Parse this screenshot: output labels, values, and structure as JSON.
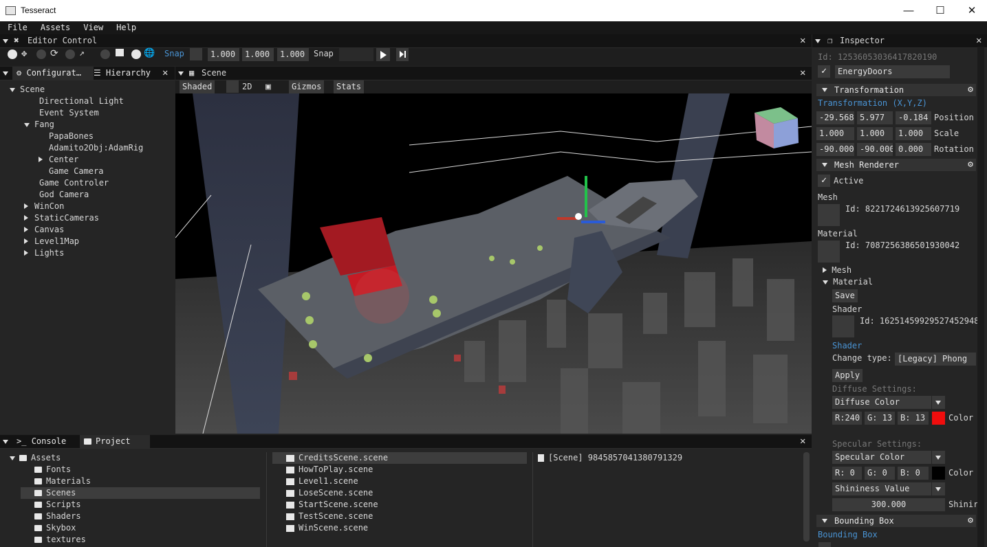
{
  "app": {
    "title": "Tesseract"
  },
  "menu": [
    "File",
    "Assets",
    "View",
    "Help"
  ],
  "editor_control": {
    "title": "Editor Control",
    "snap_label": "Snap",
    "snap_values": [
      "1.000",
      "1.000",
      "1.000"
    ],
    "snap2_label": "Snap"
  },
  "left_tabs": {
    "config": "Configurat…",
    "hierarchy": "Hierarchy"
  },
  "hierarchy": [
    {
      "label": "Scene",
      "arrow": "down",
      "depth": 0
    },
    {
      "label": "Directional Light",
      "arrow": "",
      "depth": 1
    },
    {
      "label": "Event System",
      "arrow": "",
      "depth": 1
    },
    {
      "label": "Fang",
      "arrow": "down",
      "depth": 1
    },
    {
      "label": "PapaBones",
      "arrow": "",
      "depth": 2
    },
    {
      "label": "Adamito2Obj:AdamRig",
      "arrow": "",
      "depth": 2
    },
    {
      "label": "Center",
      "arrow": "right",
      "depth": 2
    },
    {
      "label": "Game Camera",
      "arrow": "",
      "depth": 2
    },
    {
      "label": "Game Controler",
      "arrow": "",
      "depth": 1
    },
    {
      "label": "God Camera",
      "arrow": "",
      "depth": 1
    },
    {
      "label": "WinCon",
      "arrow": "right",
      "depth": 1
    },
    {
      "label": "StaticCameras",
      "arrow": "right",
      "depth": 1
    },
    {
      "label": "Canvas",
      "arrow": "right",
      "depth": 1
    },
    {
      "label": "Level1Map",
      "arrow": "right",
      "depth": 1
    },
    {
      "label": "Lights",
      "arrow": "right",
      "depth": 1
    }
  ],
  "scene": {
    "title": "Scene",
    "shaded": "Shaded",
    "mode2d": "2D",
    "gizmos": "Gizmos",
    "stats": "Stats"
  },
  "inspector": {
    "title": "Inspector",
    "id": "Id: 12536053036417820190",
    "name": "EnergyDoors",
    "transformation": {
      "title": "Transformation",
      "subtitle": "Transformation (X,Y,Z)",
      "position": [
        "-29.568",
        "5.977",
        "-0.184"
      ],
      "position_label": "Position",
      "scale": [
        "1.000",
        "1.000",
        "1.000"
      ],
      "scale_label": "Scale",
      "rotation": [
        "-90.000",
        "-90.000",
        "0.000"
      ],
      "rotation_label": "Rotation"
    },
    "mesh_renderer": {
      "title": "Mesh Renderer",
      "active": "Active",
      "mesh_label": "Mesh",
      "mesh_id": "Id: 8221724613925607719",
      "material_label": "Material",
      "material_id": "Id: 7087256386501930042",
      "mesh_node": "Mesh",
      "material_node": "Material",
      "save": "Save",
      "shader_label": "Shader",
      "shader_id": "Id: 16251459929527452948",
      "shader_link": "Shader",
      "change_type": "Change type:",
      "shader_type": "[Legacy] Phong",
      "apply": "Apply",
      "diffuse_settings": "Diffuse Settings:",
      "diffuse_select": "Diffuse Color",
      "diffuse_r": "R:240",
      "diffuse_g": "G: 13",
      "diffuse_b": "B: 13",
      "diffuse_color": "#f00d0d",
      "color_label": "Color",
      "specular_settings": "Specular Settings:",
      "specular_select": "Specular Color",
      "specular_r": "R:  0",
      "specular_g": "G:  0",
      "specular_b": "B:  0",
      "specular_color": "#000000",
      "color_label2": "Color",
      "shininess_select": "Shininess Value",
      "shininess_value": "300.000",
      "shininess_label": "Shinir"
    },
    "bounding_box": {
      "title": "Bounding Box",
      "subtitle": "Bounding Box"
    }
  },
  "bottom_tabs": {
    "console": "Console",
    "project": "Project"
  },
  "project_tree": [
    {
      "label": "Assets",
      "depth": 0,
      "arrow": "down"
    },
    {
      "label": "Fonts",
      "depth": 1,
      "arrow": ""
    },
    {
      "label": "Materials",
      "depth": 1,
      "arrow": ""
    },
    {
      "label": "Scenes",
      "depth": 1,
      "arrow": "",
      "selected": true
    },
    {
      "label": "Scripts",
      "depth": 1,
      "arrow": ""
    },
    {
      "label": "Shaders",
      "depth": 1,
      "arrow": ""
    },
    {
      "label": "Skybox",
      "depth": 1,
      "arrow": ""
    },
    {
      "label": "textures",
      "depth": 1,
      "arrow": ""
    }
  ],
  "scene_files": [
    {
      "label": "CreditsScene.scene",
      "selected": true
    },
    {
      "label": "HowToPlay.scene"
    },
    {
      "label": "Level1.scene"
    },
    {
      "label": "LoseScene.scene"
    },
    {
      "label": "StartScene.scene"
    },
    {
      "label": "TestScene.scene"
    },
    {
      "label": "WinScene.scene"
    }
  ],
  "file_detail": "[Scene] 9845857041380791329",
  "colors": {
    "accent_blue": "#4a95d6",
    "panel": "#252525",
    "header": "#131313"
  }
}
